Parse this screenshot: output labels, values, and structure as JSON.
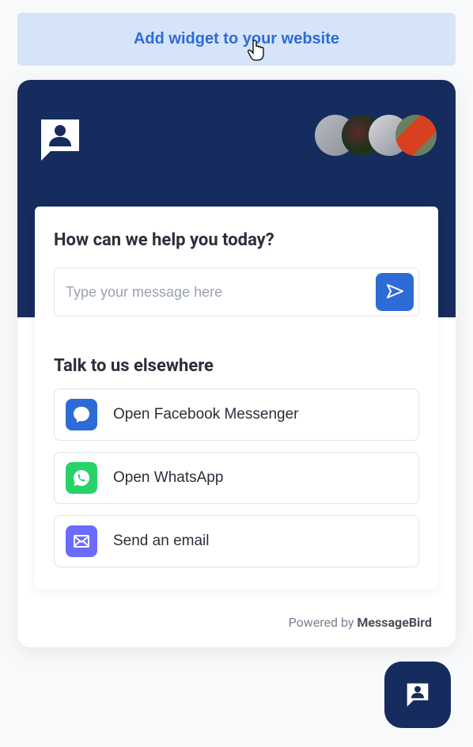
{
  "top_button": {
    "label": "Add widget to your website"
  },
  "widget": {
    "heading": "How can we help you today?",
    "input_placeholder": "Type your message here",
    "elsewhere_heading": "Talk to us elsewhere",
    "channels": [
      {
        "label": "Open Facebook Messenger",
        "icon": "messenger-icon"
      },
      {
        "label": "Open WhatsApp",
        "icon": "whatsapp-icon"
      },
      {
        "label": "Send an email",
        "icon": "email-icon"
      }
    ],
    "footer_prefix": "Powered by ",
    "footer_brand": "MessageBird"
  }
}
